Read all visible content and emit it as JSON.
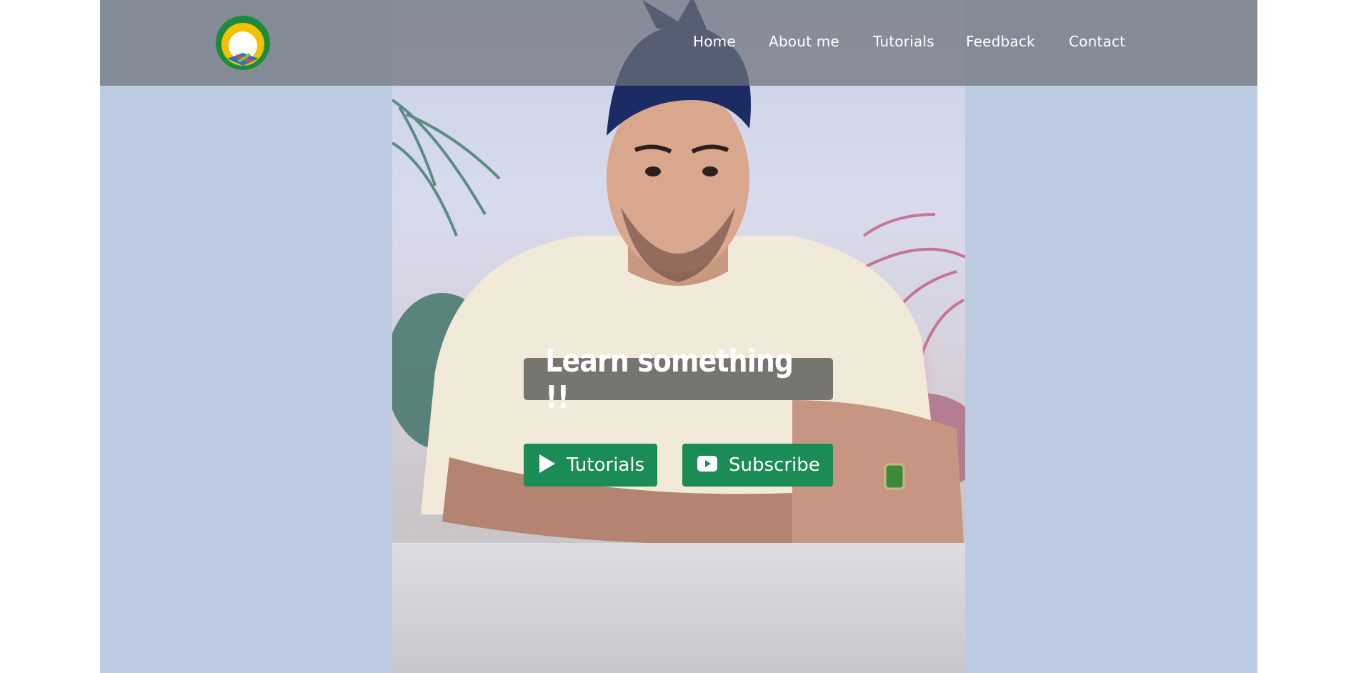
{
  "nav": {
    "items": [
      {
        "label": "Home"
      },
      {
        "label": "About me"
      },
      {
        "label": "Tutorials"
      },
      {
        "label": "Feedback"
      },
      {
        "label": "Contact"
      }
    ]
  },
  "hero": {
    "headline": "Learn something !!",
    "buttons": {
      "tutorials": {
        "label": "Tutorials",
        "icon": "play-icon"
      },
      "subscribe": {
        "label": "Subscribe",
        "icon": "youtube-icon"
      }
    }
  },
  "colors": {
    "page_background": "#bccbe2",
    "navbar": "#6e727a",
    "button": "#1b8c55",
    "logo_outer": "#1b8c3a",
    "logo_inner": "#f2c200"
  }
}
